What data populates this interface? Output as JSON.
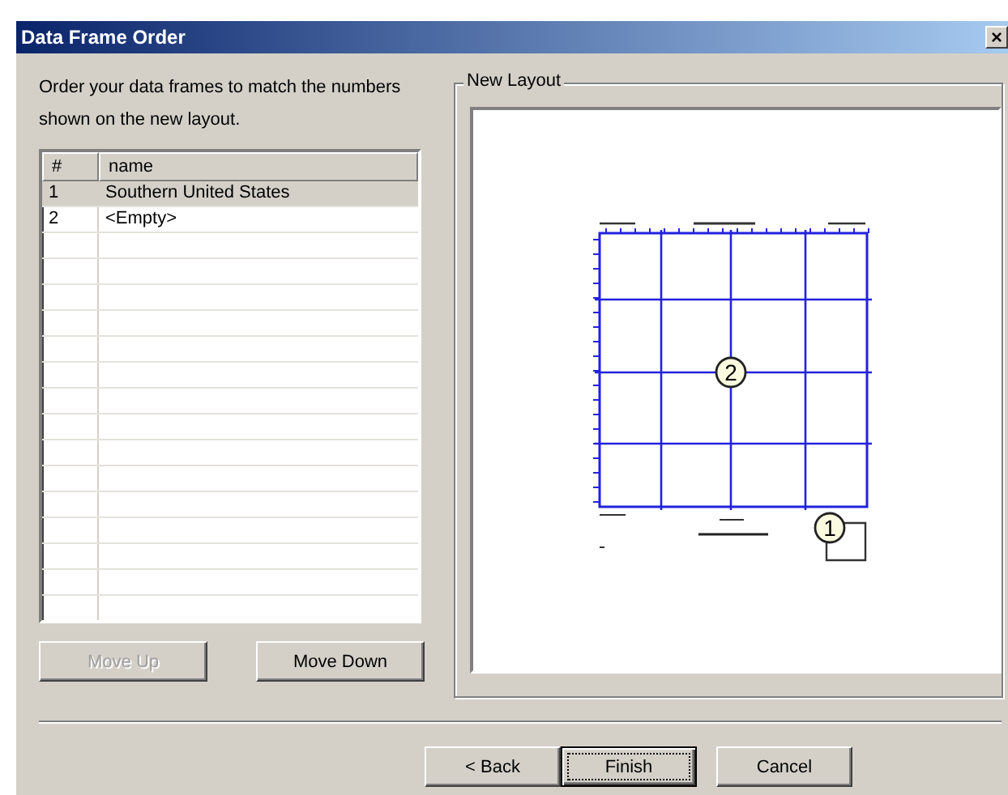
{
  "window": {
    "title": "Data Frame Order",
    "close": "×"
  },
  "instructions": "Order your data frames to match the numbers shown on the new layout.",
  "table": {
    "columns": [
      "#",
      "name"
    ],
    "rows": [
      {
        "cells": [
          "1",
          "Southern United States"
        ],
        "selected": true
      },
      {
        "cells": [
          "2",
          "<Empty>"
        ],
        "selected": false
      }
    ]
  },
  "move_buttons": [
    {
      "label": "Move Up",
      "disabled": true
    },
    {
      "label": "Move Down",
      "disabled": false
    }
  ],
  "layout_group": {
    "title": "New Layout",
    "markers": [
      {
        "label": "2",
        "kind": "map"
      },
      {
        "label": "1",
        "kind": "inset"
      }
    ]
  },
  "footer_buttons": [
    {
      "label": "< Back",
      "default": false
    },
    {
      "label": "Finish",
      "default": true
    },
    {
      "label": "Cancel",
      "default": false
    }
  ]
}
